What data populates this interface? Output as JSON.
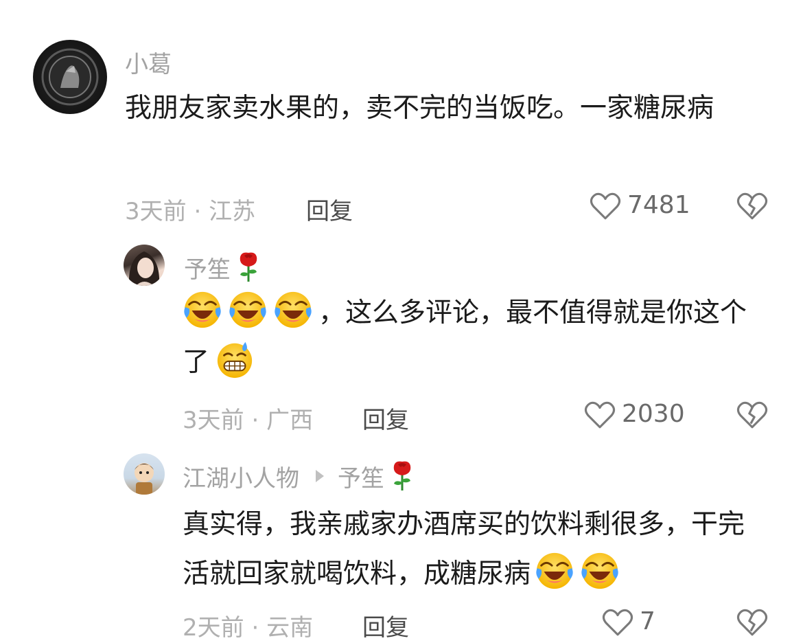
{
  "comments": [
    {
      "username": "小葛",
      "text": "我朋友家卖水果的，卖不完的当饭吃。一家糖尿病",
      "time": "3天前",
      "location": "江苏",
      "reply_label": "回复",
      "likes": "7481"
    },
    {
      "username": "予笙",
      "text_after_emoji": "，这么多评论，最不值得就是你这个了",
      "time": "3天前",
      "location": "广西",
      "reply_label": "回复",
      "likes": "2030"
    },
    {
      "username": "江湖小人物",
      "reply_to": "予笙",
      "text": "真实得，我亲戚家办酒席买的饮料剩很多，干完活就回家就喝饮料，成糖尿病",
      "time": "2天前",
      "location": "云南",
      "reply_label": "回复",
      "likes": "7"
    }
  ],
  "separator": " · ",
  "icons": {
    "like": "heart-outline-icon",
    "dislike": "broken-heart-icon",
    "laugh_cry": "rolling-on-floor-laughing-emoji",
    "sweat_grin": "grinning-sweat-emoji",
    "rose": "rose-emoji"
  },
  "colors": {
    "username": "#a3a3a3",
    "meta": "#b0b0b0",
    "text": "#1b1b1b"
  }
}
